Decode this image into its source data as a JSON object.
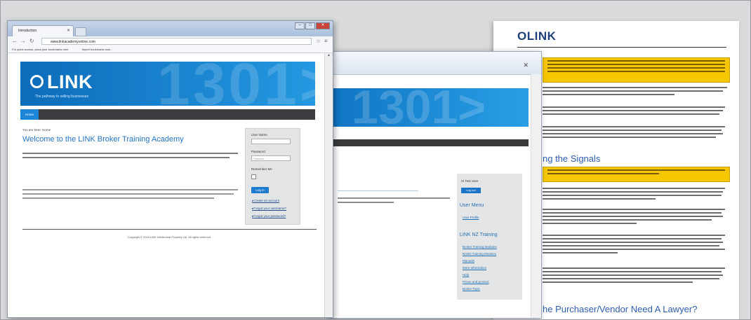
{
  "document": {
    "logo": "OLINK",
    "headings": [
      "ng the Signals",
      "he Purchaser/Vendor Need A Lawyer?"
    ]
  },
  "middle_window": {
    "sidebar": {
      "label": "Hi Test User",
      "button": "Log out",
      "section1_title": "User Menu",
      "section1_items": [
        "User Profile"
      ],
      "section2_title": "LINK NZ Training",
      "section2_items": [
        "Broker Training Modules",
        "BAND Training Modules",
        "Manuals",
        "More Information",
        "Help",
        "Prices and product",
        "Broker Topic"
      ]
    }
  },
  "browser": {
    "tab_title": "Introduction",
    "url": "www.linkacademyonline.com",
    "bookmarks": [
      "For quick access, place your bookmarks here",
      "Import bookmarks now..."
    ],
    "window_buttons": [
      "–",
      "□",
      "✕"
    ]
  },
  "site": {
    "brand": "LINK",
    "banner_number": "1301>",
    "tagline": "The pathway to selling businesses",
    "nav_home": "Home",
    "breadcrumb": "You are here: Home",
    "welcome": "Welcome to the LINK Broker Training Academy",
    "login": {
      "username_label": "User Name",
      "password_label": "Password",
      "password_placeholder": "Password",
      "remember_label": "Remember Me",
      "login_button": "Log in",
      "links": [
        "Create an account",
        "Forgot your username?",
        "Forgot your password?"
      ]
    },
    "footer": "Copyright © 2016 LINK Intellectual Property Ltd. All rights reserved."
  }
}
